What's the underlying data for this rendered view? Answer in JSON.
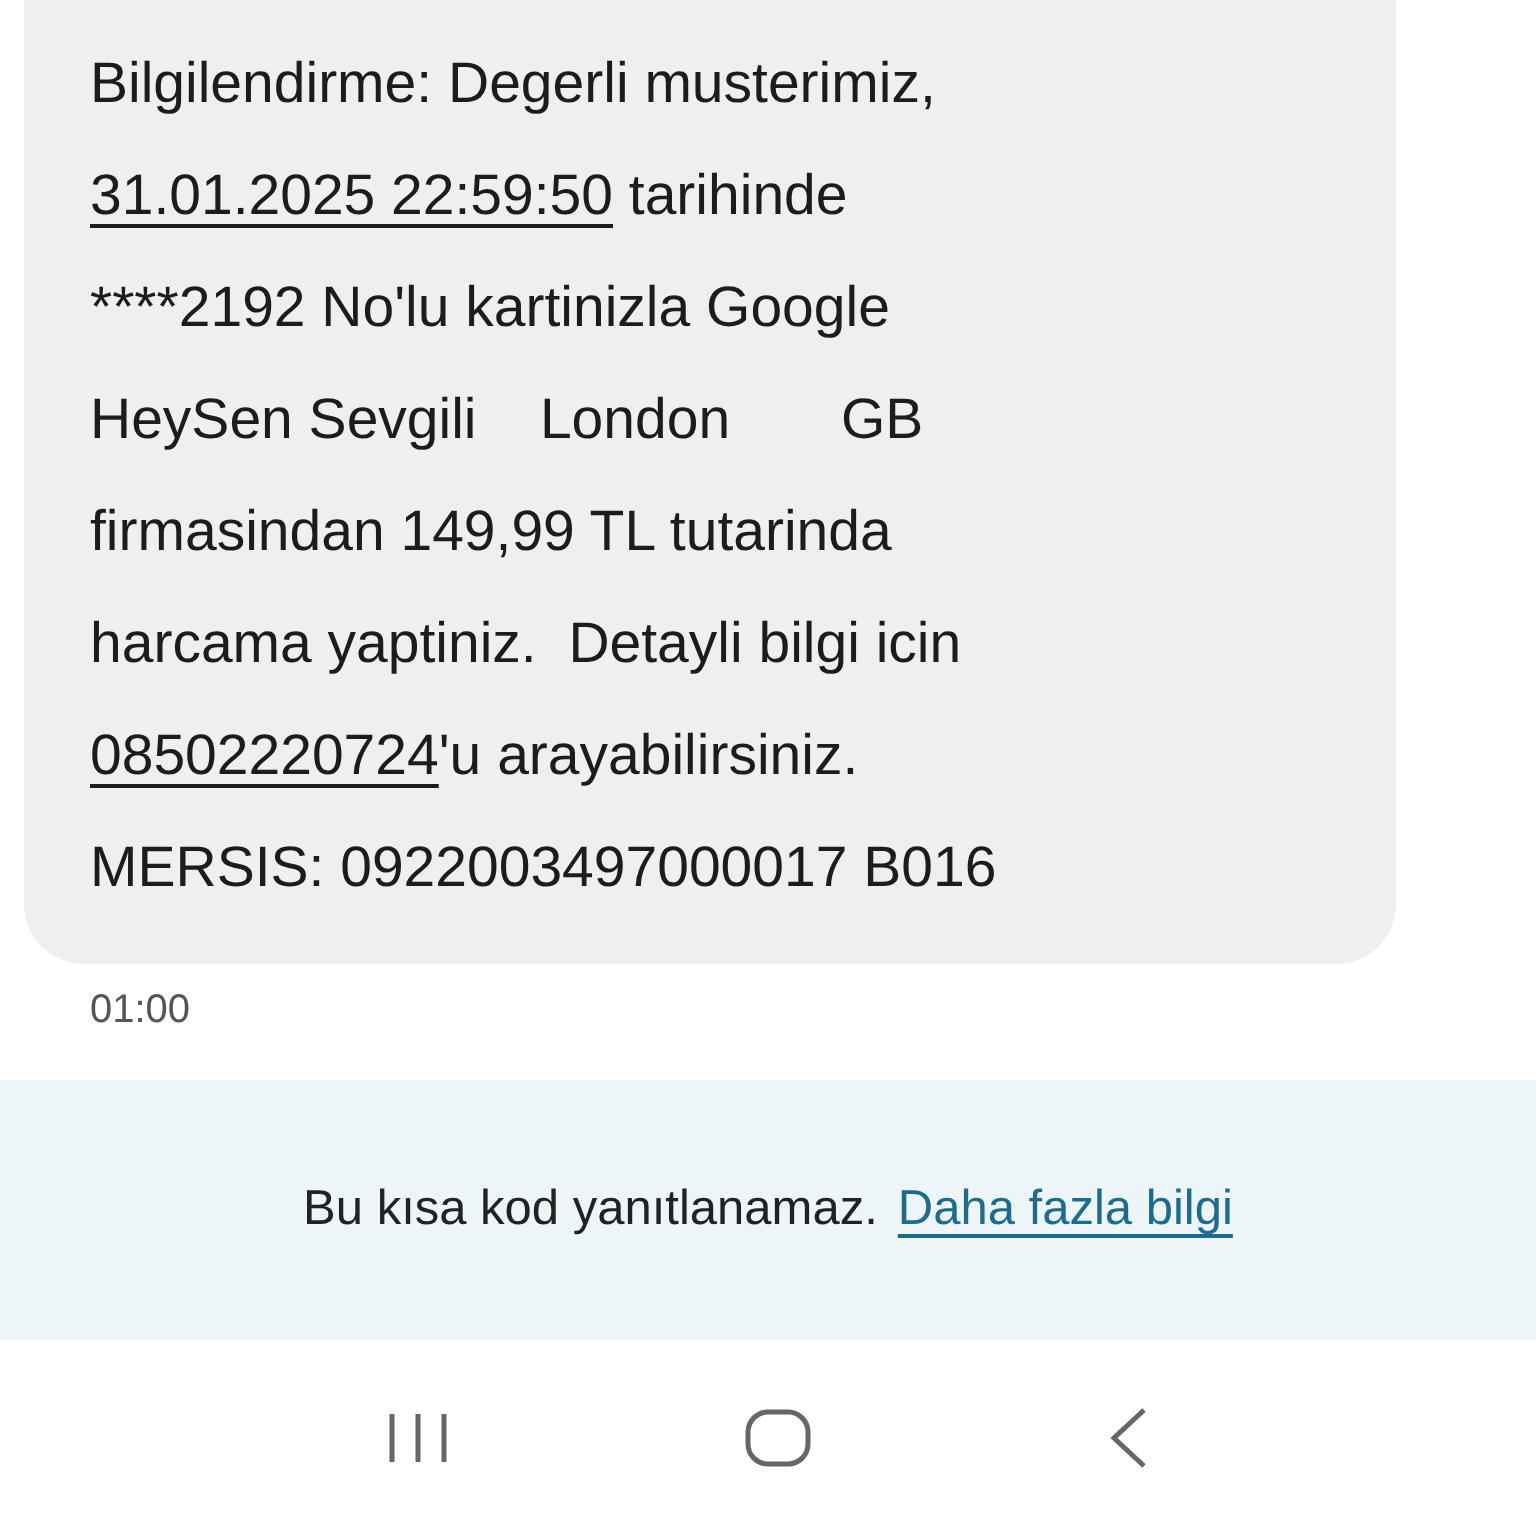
{
  "message": {
    "segments": [
      {
        "kind": "text",
        "text": "Bilgilendirme: Degerli musterimiz,\n"
      },
      {
        "kind": "link",
        "text": "31.01.2025 22:59:50"
      },
      {
        "kind": "text",
        "text": " tarihinde\n****2192 No'lu kartinizla Google\nHeySen Sevgili    London       GB\nfirmasindan 149,99 TL tutarinda\nharcama yaptiniz.  Detayli bilgi icin\n"
      },
      {
        "kind": "link",
        "text": "08502220724"
      },
      {
        "kind": "text",
        "text": "'u arayabilirsiniz.\nMERSIS: 0922003497000017 B016"
      }
    ],
    "time": "01:00"
  },
  "notice": {
    "text": "Bu kısa kod yanıtlanamaz.",
    "link": "Daha fazla bilgi"
  },
  "nav_bar": {
    "buttons": [
      {
        "kind": "recents"
      },
      {
        "kind": "home"
      },
      {
        "kind": "back"
      }
    ]
  }
}
